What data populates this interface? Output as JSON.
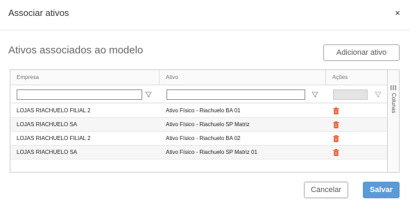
{
  "dialog": {
    "title": "Associar ativos",
    "close_glyph": "×"
  },
  "section": {
    "title": "Ativos associados ao modelo",
    "add_button": "Adicionar ativo"
  },
  "grid": {
    "columns": [
      "Empresa",
      "Ativo",
      "Ações"
    ],
    "filters": {
      "empresa": "",
      "ativo": ""
    },
    "rows": [
      {
        "empresa": "LOJAS RIACHUELO FILIAL 2",
        "ativo": "Ativo Físico - Riachuelo BA 01"
      },
      {
        "empresa": "LOJAS RIACHUELO SA",
        "ativo": "Ativo Físico - Riachuelo SP Matriz"
      },
      {
        "empresa": "LOJAS RIACHUELO FILIAL 2",
        "ativo": "Ativo Físico - Riachuelo BA 02"
      },
      {
        "empresa": "LOJAS RIACHUELO SA",
        "ativo": "Ativo Físico - Riachuelo SP Matriz 01"
      }
    ],
    "columns_panel_label": "Colunas",
    "icons": {
      "filter": "filter-icon",
      "delete": "trash-icon",
      "columns": "columns-icon"
    }
  },
  "footer": {
    "cancel": "Cancelar",
    "save": "Salvar"
  },
  "colors": {
    "primary": "#5b9bd5",
    "delete": "#e8552c"
  }
}
